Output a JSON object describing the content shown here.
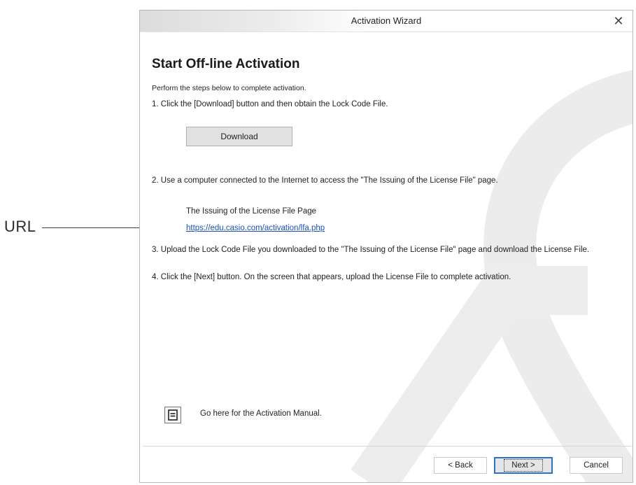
{
  "callout": {
    "label": "URL"
  },
  "window": {
    "title": "Activation Wizard",
    "close_glyph": "✕"
  },
  "content": {
    "heading": "Start Off-line Activation",
    "intro": "Perform the steps below to complete activation.",
    "step1": "1. Click the [Download] button and then obtain the Lock Code File.",
    "download_label": "Download",
    "step2": "2. Use a computer connected to the Internet to access the \"The Issuing of the License File\" page.",
    "page_label": "The Issuing of the License File Page",
    "url": "https://edu.casio.com/activation/lfa.php",
    "step3": "3. Upload the Lock Code File you downloaded to the \"The Issuing of the License File\" page and download the License File.",
    "step4": "4. Click the [Next] button. On the screen that appears, upload the License File to complete activation.",
    "manual_icon": "document-icon",
    "manual_text": "Go here for the Activation Manual."
  },
  "footer": {
    "back_label": "< Back",
    "next_label": "Next >",
    "cancel_label": "Cancel"
  },
  "colors": {
    "link": "#1a4fc4",
    "focus_border": "#2a73c8",
    "watermark": "#e6e6e6"
  }
}
